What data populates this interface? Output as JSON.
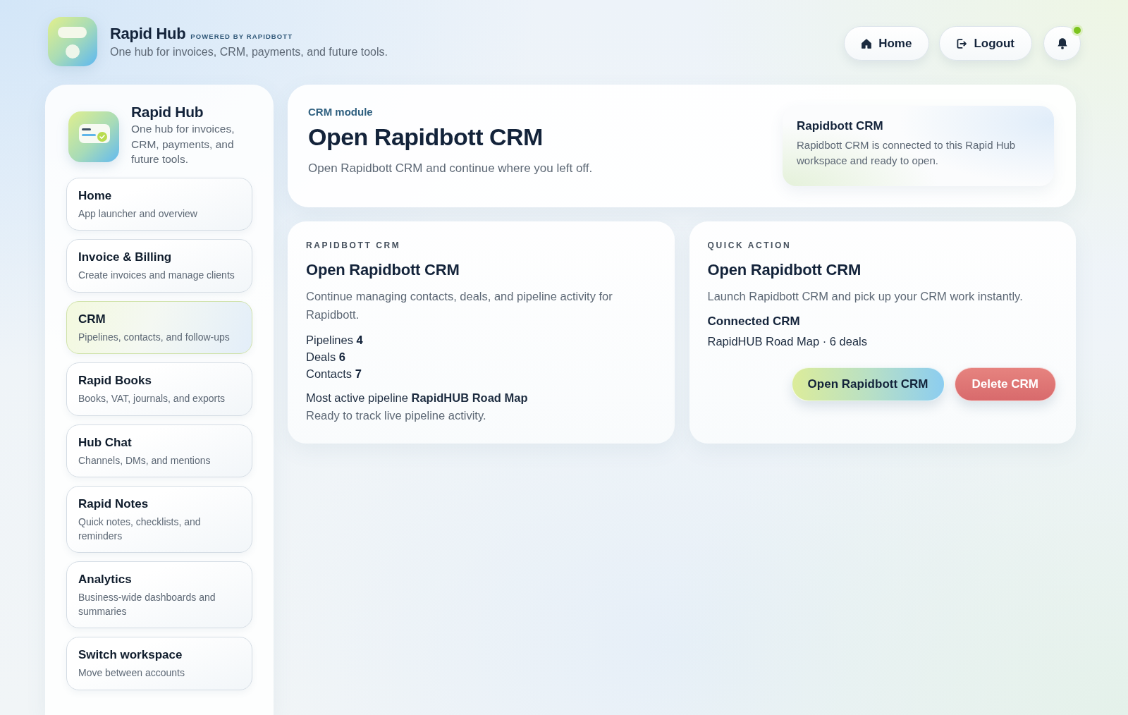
{
  "header": {
    "app_name": "Rapid Hub",
    "powered_by": "POWERED BY RAPIDBOTT",
    "tagline": "One hub for invoices, CRM, payments, and future tools."
  },
  "top_actions": [
    {
      "kind": "home",
      "label": "Home"
    },
    {
      "kind": "logout",
      "label": "Logout"
    }
  ],
  "notifications": {
    "unread": true
  },
  "sidebar": {
    "brand": {
      "title": "Rapid Hub",
      "description": "One hub for invoices, CRM, payments, and future tools."
    },
    "items": [
      {
        "title": "Home",
        "description": "App launcher and overview",
        "selected": false
      },
      {
        "title": "Invoice & Billing",
        "description": "Create invoices and manage clients",
        "selected": false
      },
      {
        "title": "CRM",
        "description": "Pipelines, contacts, and follow-ups",
        "selected": true
      },
      {
        "title": "Rapid Books",
        "description": "Books, VAT, journals, and exports",
        "selected": false
      },
      {
        "title": "Hub Chat",
        "description": "Channels, DMs, and mentions",
        "selected": false
      },
      {
        "title": "Rapid Notes",
        "description": "Quick notes, checklists, and reminders",
        "selected": false
      },
      {
        "title": "Analytics",
        "description": "Business-wide dashboards and summaries",
        "selected": false
      },
      {
        "title": "Switch workspace",
        "description": "Move between accounts",
        "selected": false
      }
    ]
  },
  "hero": {
    "eyebrow": "CRM module",
    "title": "Open Rapidbott CRM",
    "subtitle": "Open Rapidbott CRM and continue where you left off.",
    "status_panel": {
      "title": "Rapidbott CRM",
      "text": "Rapidbott CRM is connected to this Rapid Hub workspace and ready to open."
    }
  },
  "overview_card": {
    "eyebrow": "RAPIDBOTT CRM",
    "title": "Open Rapidbott CRM",
    "description": "Continue managing contacts, deals, and pipeline activity for Rapidbott.",
    "stats": [
      {
        "label": "Pipelines",
        "value": "4"
      },
      {
        "label": "Deals",
        "value": "6"
      },
      {
        "label": "Contacts",
        "value": "7"
      }
    ],
    "pipeline_line": "Most active pipeline **RapidHUB Road Map**",
    "note": "Ready to track live pipeline activity."
  },
  "quick_action": {
    "eyebrow": "QUICK ACTION",
    "title": "Open Rapidbott CRM",
    "description": "Launch Rapidbott CRM and pick up your CRM work instantly.",
    "connected_label": "Connected CRM",
    "connected_value": "RapidHUB Road Map · 6 deals",
    "buttons": [
      {
        "kind": "open",
        "label": "Open Rapidbott CRM"
      },
      {
        "kind": "delete",
        "label": "Delete CRM"
      }
    ]
  }
}
